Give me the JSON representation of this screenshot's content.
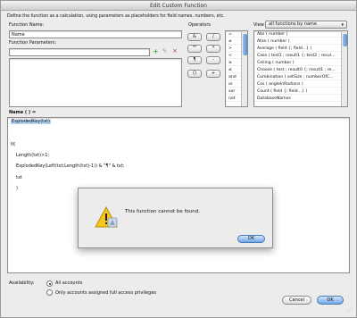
{
  "window": {
    "title": "Edit Custom Function"
  },
  "instructions": "Define the function as a calculation, using parameters as placeholders for field names, numbers, etc.",
  "function_name": {
    "label": "Function Name:",
    "value": "Name"
  },
  "parameters": {
    "label": "Function Parameters:",
    "add": "+",
    "edit": "✎",
    "remove": "×"
  },
  "operators": {
    "label": "Operators",
    "buttons": [
      "&",
      "/",
      "\"\"",
      "*",
      "¶",
      "-",
      "()",
      "+"
    ],
    "list": [
      "=",
      "≠",
      ">",
      "<",
      "≥",
      "≤",
      "and",
      "or",
      "xor",
      "not"
    ]
  },
  "view": {
    "label": "View",
    "selected": "all functions by name",
    "functions": [
      "Abs ( number )",
      "Atan ( number )",
      "Average ( field {; field...} )",
      "Case ( test1 ; result1 {; test2 ; resul…",
      "Ceiling ( number )",
      "Choose ( test ; result0 {; result1 ; re…",
      "Combination ( setSize ; numberOfC…",
      "Cos ( angleInRadians )",
      "Count ( field {; field...} )",
      "DatabaseNames"
    ]
  },
  "formula": {
    "label": "Name ( ) =",
    "lines": [
      "ExplodedKey(txt)",
      "",
      "",
      "If(",
      "",
      "Length(txt)>1;",
      "",
      "ExplodedKey(Left(txt;Length(txt)-1)) & \"¶\" & txt;",
      "",
      "txt",
      "",
      ")"
    ]
  },
  "alert": {
    "message": "This function cannot be found.",
    "ok": "OK"
  },
  "availability": {
    "label": "Availability:",
    "options": [
      "All accounts",
      "Only accounts assigned full access privileges"
    ],
    "selected": 0
  },
  "footer": {
    "cancel": "Cancel",
    "ok": "OK"
  }
}
